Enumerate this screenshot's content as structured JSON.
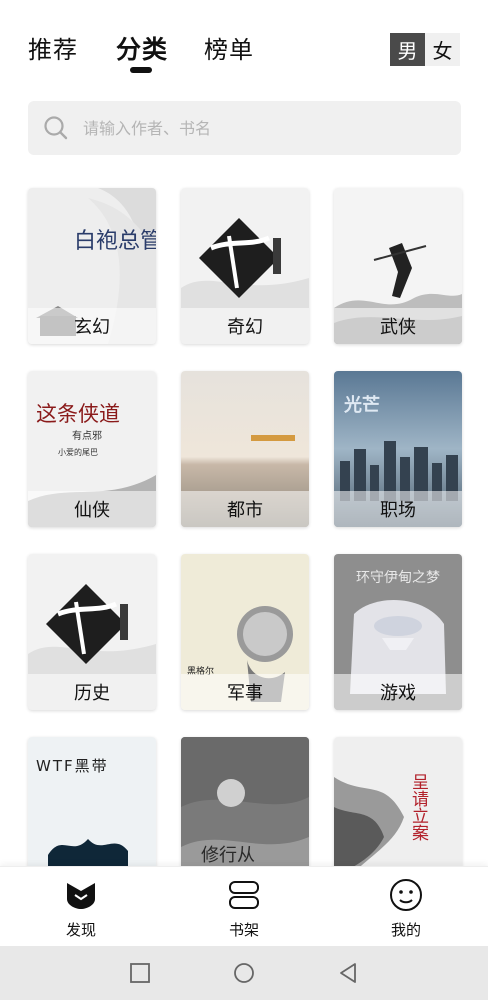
{
  "header": {
    "tabs": [
      "推荐",
      "分类",
      "榜单"
    ],
    "active_tab": "分类",
    "gender": {
      "male": "男",
      "female": "女",
      "selected": "男"
    }
  },
  "search": {
    "placeholder": "请输入作者、书名"
  },
  "categories": [
    {
      "label": "玄幻"
    },
    {
      "label": "奇幻"
    },
    {
      "label": "武侠"
    },
    {
      "label": "仙侠"
    },
    {
      "label": "都市"
    },
    {
      "label": "职场"
    },
    {
      "label": "历史"
    },
    {
      "label": "军事"
    },
    {
      "label": "游戏"
    },
    {
      "label": ""
    },
    {
      "label": ""
    },
    {
      "label": ""
    }
  ],
  "cover_text": {
    "c1": "白袍总管",
    "c4": "这条侠道",
    "c4_sub": "有点邪",
    "c4_author": "小爱的尾巴",
    "c9": "环守伊甸之梦",
    "c10": "WTF黑带",
    "c11": "修行从",
    "c12": "呈请立案",
    "c8_author": "黑格尔"
  },
  "colors": {
    "accent": "#111111",
    "toggle_on": "#4a4a4a",
    "search_bg": "#f0f0f0",
    "system_bar": "#e8e8e8"
  },
  "bottom_nav": [
    {
      "label": "发现",
      "icon": "discover-icon"
    },
    {
      "label": "书架",
      "icon": "bookshelf-icon"
    },
    {
      "label": "我的",
      "icon": "profile-icon"
    }
  ],
  "system_nav": [
    "recent-apps-icon",
    "home-icon",
    "back-icon"
  ]
}
